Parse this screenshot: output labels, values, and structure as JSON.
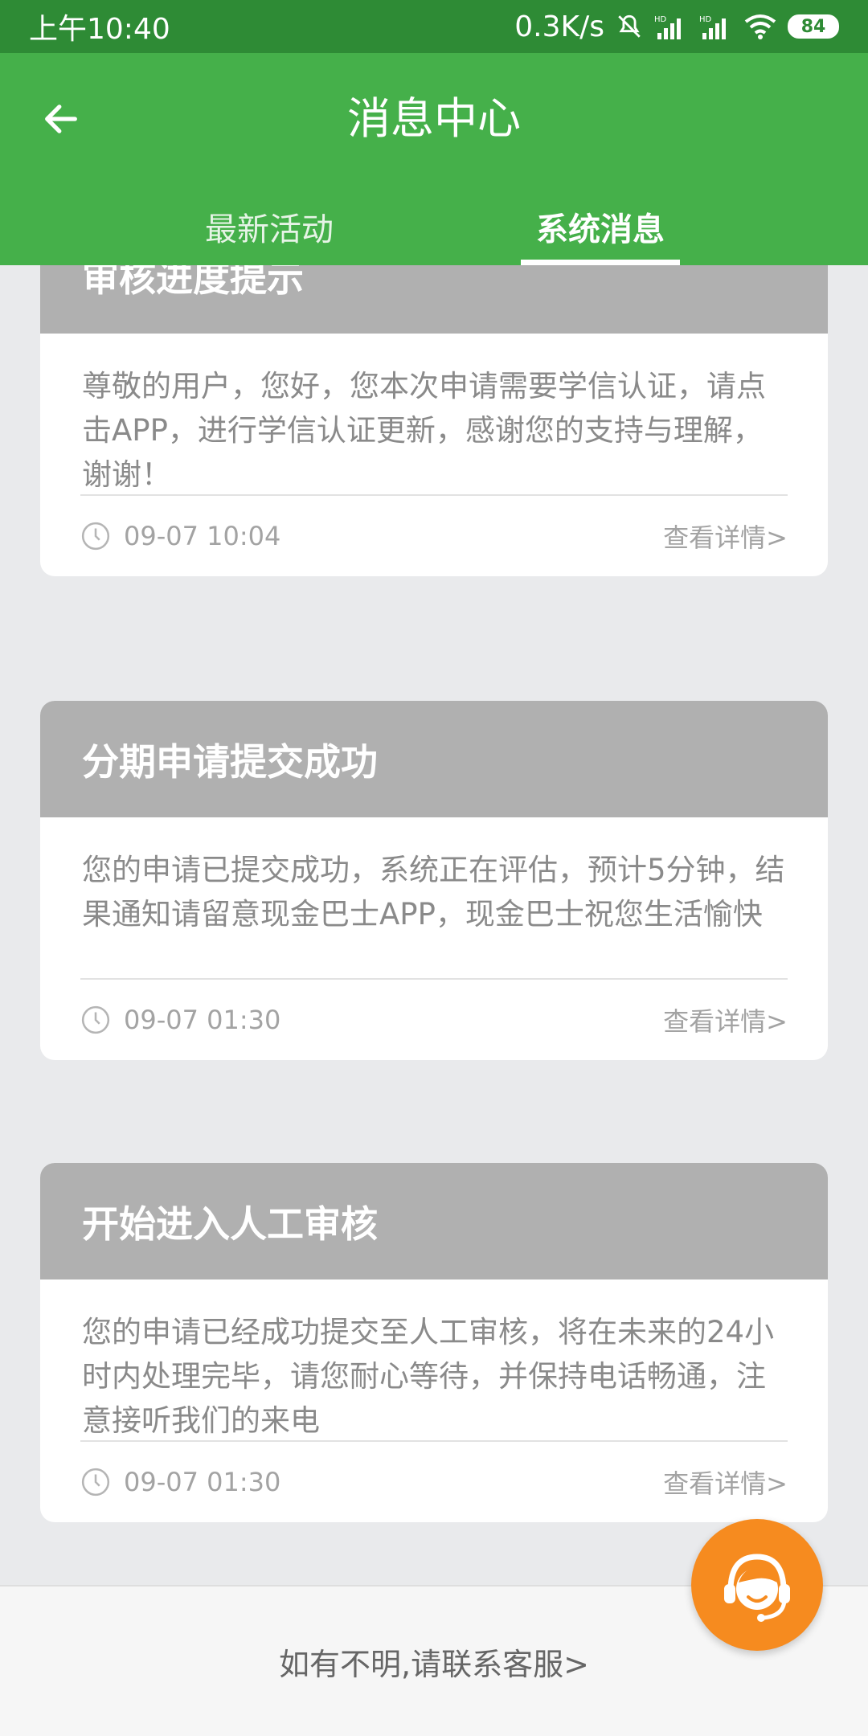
{
  "status_bar": {
    "time": "上午10:40",
    "net_speed": "0.3K/s",
    "battery": "84",
    "icons": [
      "mute-bell-icon",
      "signal-hd-icon",
      "signal-hd-icon",
      "wifi-icon",
      "battery-icon"
    ]
  },
  "header": {
    "title": "消息中心",
    "back_icon": "back-arrow-icon",
    "tabs": [
      {
        "label": "最新活动",
        "active": false
      },
      {
        "label": "系统消息",
        "active": true
      }
    ]
  },
  "colors": {
    "header_green": "#45b04a",
    "status_green": "#2e8b35",
    "card_head_gray": "#b0b0b0",
    "fab_orange": "#f68b1f"
  },
  "messages": [
    {
      "title": "审核进度提示",
      "body": "尊敬的用户，您好，您本次申请需要学信认证，请点击APP，进行学信认证更新，感谢您的支持与理解，谢谢！",
      "time": "09-07 10:04",
      "detail": "查看详情>"
    },
    {
      "title": "分期申请提交成功",
      "body": "您的申请已提交成功，系统正在评估，预计5分钟，结果通知请留意现金巴士APP，现金巴士祝您生活愉快",
      "time": "09-07 01:30",
      "detail": "查看详情>"
    },
    {
      "title": "开始进入人工审核",
      "body": "您的申请已经成功提交至人工审核，将在未来的24小时内处理完毕，请您耐心等待，并保持电话畅通，注意接听我们的来电",
      "time": "09-07 01:30",
      "detail": "查看详情>"
    }
  ],
  "footer": {
    "text": "如有不明,请联系客服>"
  },
  "fab": {
    "icon": "customer-service-icon"
  }
}
